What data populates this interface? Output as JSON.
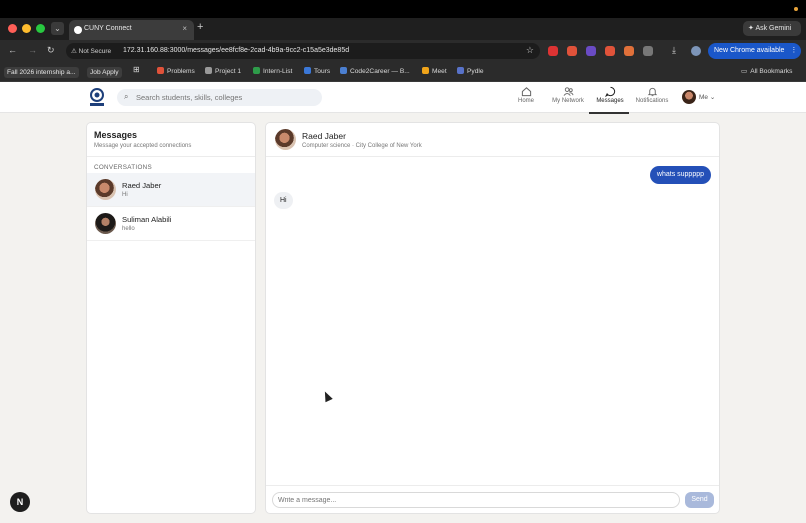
{
  "browser": {
    "tab_title": "CUNY Connect",
    "new_tab_symbol": "+",
    "tab_close_symbol": "×",
    "gemini_label": "Ask Gemini",
    "not_secure_label": "Not Secure",
    "url": "172.31.160.88:3000/messages/ee8fcf8e-2cad-4b9a-9cc2-c15a5e3de85d",
    "update_label": "New Chrome available",
    "bookmarks": [
      "Fall 2026 internship a...",
      "Job Apply",
      "Problems",
      "Project 1",
      "Intern-List",
      "Tours",
      "Code2Career — B...",
      "Meet",
      "Pydle"
    ],
    "all_bookmarks_label": "All Bookmarks"
  },
  "header": {
    "search_placeholder": "Search students, skills, colleges",
    "nav": [
      {
        "label": "Home",
        "icon": "home-icon"
      },
      {
        "label": "My Network",
        "icon": "network-icon"
      },
      {
        "label": "Messages",
        "icon": "messages-icon",
        "active": true
      },
      {
        "label": "Notifications",
        "icon": "bell-icon"
      }
    ],
    "me_label": "Me"
  },
  "sidebar": {
    "title": "Messages",
    "subtitle": "Message your accepted connections",
    "section_label": "CONVERSATIONS",
    "conversations": [
      {
        "name": "Raed Jaber",
        "last_message": "Hi",
        "active": true
      },
      {
        "name": "Suliman Alabili",
        "last_message": "hello",
        "active": false
      }
    ]
  },
  "chat": {
    "contact_name": "Raed Jaber",
    "contact_info": "Computer science · City College of New York",
    "messages": [
      {
        "direction": "outgoing",
        "text": "whats suppppp"
      },
      {
        "direction": "incoming",
        "text": "Hi"
      }
    ],
    "composer_placeholder": "Write a message...",
    "send_label": "Send"
  },
  "badge": {
    "letter": "N"
  },
  "colors": {
    "accent": "#2450b8",
    "send_disabled": "#a9b9db",
    "chrome_update": "#1a57c9",
    "page_background": "#f3f2ef"
  }
}
